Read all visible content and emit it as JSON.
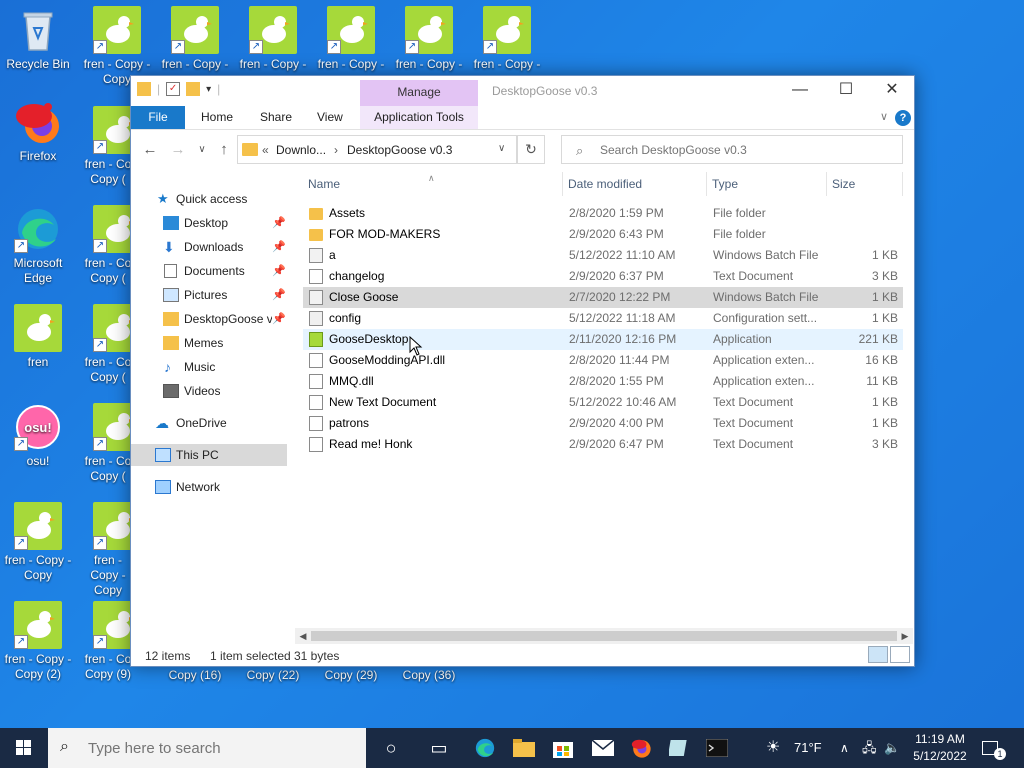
{
  "desktop": {
    "recycle_bin": "Recycle Bin",
    "firefox": "Firefox",
    "edge": "Microsoft Edge",
    "fren": "fren",
    "osu": "osu!",
    "top_row": [
      "fren - Copy - Copy",
      "fren - Copy -",
      "fren - Copy -",
      "fren - Copy -",
      "fren - Copy -",
      "fren - Copy -"
    ],
    "col2": [
      "fren - Co Copy (",
      "fren - Co Copy (",
      "fren - Co Copy (",
      "fren - Co Copy (",
      "fren - Copy - Copy",
      "fren - Co Copy (9)"
    ],
    "col1_bottom": [
      "fren - Copy - Copy",
      "fren - Copy - Copy (2)"
    ],
    "bottom_peek": [
      "Copy (16)",
      "Copy (22)",
      "Copy (29)",
      "Copy (36)"
    ]
  },
  "window": {
    "title": "DesktopGoose v0.3",
    "manage_tab": "Manage",
    "tabs": {
      "file": "File",
      "home": "Home",
      "share": "Share",
      "view": "View",
      "app_tools": "Application Tools"
    },
    "address": {
      "prefix": "«",
      "crumb1": "Downlo...",
      "sep": "›",
      "crumb2": "DesktopGoose v0.3"
    },
    "search_placeholder": "Search DesktopGoose v0.3",
    "nav": {
      "quick_access": "Quick access",
      "desktop": "Desktop",
      "downloads": "Downloads",
      "documents": "Documents",
      "pictures": "Pictures",
      "desktopgoose": "DesktopGoose v(",
      "memes": "Memes",
      "music": "Music",
      "videos": "Videos",
      "onedrive": "OneDrive",
      "this_pc": "This PC",
      "network": "Network"
    },
    "columns": {
      "name": "Name",
      "date": "Date modified",
      "type": "Type",
      "size": "Size"
    },
    "files": [
      {
        "name": "Assets",
        "date": "2/8/2020 1:59 PM",
        "type": "File folder",
        "size": "",
        "icon": "folder"
      },
      {
        "name": "FOR MOD-MAKERS",
        "date": "2/9/2020 6:43 PM",
        "type": "File folder",
        "size": "",
        "icon": "folder"
      },
      {
        "name": "a",
        "date": "5/12/2022 11:10 AM",
        "type": "Windows Batch File",
        "size": "1 KB",
        "icon": "bat"
      },
      {
        "name": "changelog",
        "date": "2/9/2020 6:37 PM",
        "type": "Text Document",
        "size": "3 KB",
        "icon": "doc"
      },
      {
        "name": "Close Goose",
        "date": "2/7/2020 12:22 PM",
        "type": "Windows Batch File",
        "size": "1 KB",
        "icon": "bat"
      },
      {
        "name": "config",
        "date": "5/12/2022 11:18 AM",
        "type": "Configuration sett...",
        "size": "1 KB",
        "icon": "cfg"
      },
      {
        "name": "GooseDesktop",
        "date": "2/11/2020 12:16 PM",
        "type": "Application",
        "size": "221 KB",
        "icon": "app"
      },
      {
        "name": "GooseModdingAPI.dll",
        "date": "2/8/2020 11:44 PM",
        "type": "Application exten...",
        "size": "16 KB",
        "icon": "dll"
      },
      {
        "name": "MMQ.dll",
        "date": "2/8/2020 1:55 PM",
        "type": "Application exten...",
        "size": "11 KB",
        "icon": "dll"
      },
      {
        "name": "New Text Document",
        "date": "5/12/2022 10:46 AM",
        "type": "Text Document",
        "size": "1 KB",
        "icon": "doc"
      },
      {
        "name": "patrons",
        "date": "2/9/2020 4:00 PM",
        "type": "Text Document",
        "size": "1 KB",
        "icon": "doc"
      },
      {
        "name": "Read me! Honk",
        "date": "2/9/2020 6:47 PM",
        "type": "Text Document",
        "size": "3 KB",
        "icon": "doc"
      }
    ],
    "status": {
      "items": "12 items",
      "selected": "1 item selected",
      "bytes": "31 bytes"
    }
  },
  "taskbar": {
    "search_placeholder": "Type here to search",
    "weather": "71°F",
    "time": "11:19 AM",
    "date": "5/12/2022",
    "notifications": "1"
  },
  "colors": {
    "accent": "#1979ca",
    "manage_tab": "#e3c4f4",
    "selection": "#d9d9d9",
    "hover": "#e5f3ff",
    "desktop": "#1f86e8",
    "taskbar": "#1a2a44"
  }
}
